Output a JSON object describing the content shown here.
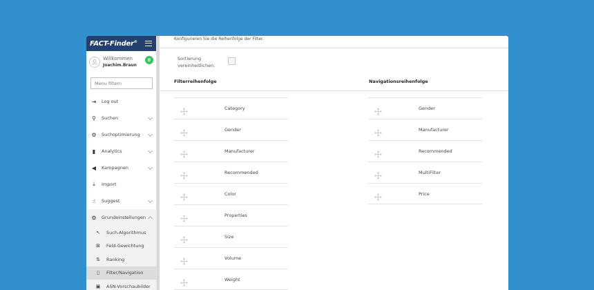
{
  "sidebar": {
    "brand": "FACT-Finder",
    "brand_mark": "®",
    "user": {
      "welcome": "Willkommen",
      "name": "Joachim.Braun",
      "badge": "0"
    },
    "filter_placeholder": "Menu filtern",
    "items": [
      {
        "label": "Log out",
        "icon": "logout-icon"
      },
      {
        "label": "Suchen",
        "icon": "search-icon"
      },
      {
        "label": "Suchoptimierung",
        "icon": "gear-search-icon"
      },
      {
        "label": "Analytics",
        "icon": "bar-chart-icon"
      },
      {
        "label": "Kampagnen",
        "icon": "megaphone-icon"
      },
      {
        "label": "Import",
        "icon": "download-icon"
      },
      {
        "label": "Suggest",
        "icon": "suggest-icon"
      },
      {
        "label": "Grundeinstellungen",
        "icon": "gear-icon"
      }
    ],
    "sub_items": [
      {
        "label": "Such-Algorithmus",
        "icon": "algorithm-icon"
      },
      {
        "label": "Feld-Gewichtung",
        "icon": "weight-icon"
      },
      {
        "label": "Ranking",
        "icon": "ranking-icon"
      },
      {
        "label": "Filter/Navigation",
        "icon": "filter-icon"
      },
      {
        "label": "ASN-Vorschaubilder",
        "icon": "image-icon"
      }
    ]
  },
  "main": {
    "description": "Konfigurieren Sie die Reihenfolge der Filter.",
    "sort_label_line1": "Sortierung",
    "sort_label_line2": "vereinheitlichen:",
    "filter_title": "Filterreihenfolge",
    "nav_title": "Navigationsreihenfolge",
    "filter_items": [
      "Category",
      "Gender",
      "Manufacturer",
      "Recommended",
      "Color",
      "Properties",
      "Size",
      "Volume",
      "Weight"
    ],
    "nav_items": [
      "Gender",
      "Manufacturer",
      "Recommended",
      "MultiFilter",
      "Price"
    ]
  },
  "colors": {
    "background": "#3390cf",
    "brand": "#23406f",
    "badge": "#34c759"
  }
}
